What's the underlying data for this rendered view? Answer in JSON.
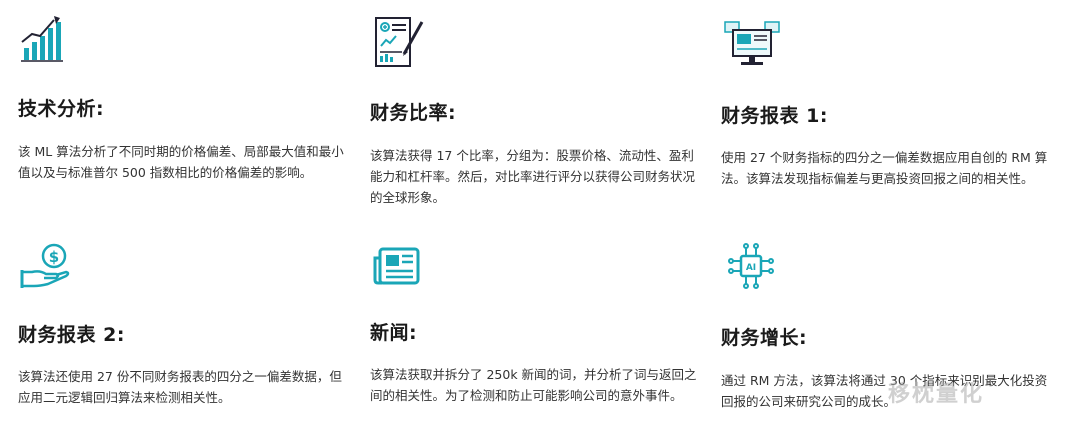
{
  "accent_color": "#1aa6b7",
  "cards": [
    {
      "icon": "growth-chart-icon",
      "title": "技术分析:",
      "desc": "该 ML 算法分析了不同时期的价格偏差、局部最大值和最小值以及与标准普尔 500 指数相比的价格偏差的影响。"
    },
    {
      "icon": "report-document-icon",
      "title": "财务比率:",
      "desc": "该算法获得 17 个比率，分组为：股票价格、流动性、盈利能力和杠杆率。然后，对比率进行评分以获得公司财务状况的全球形象。"
    },
    {
      "icon": "monitor-dashboard-icon",
      "title": "财务报表 1:",
      "desc": "使用 27 个财务指标的四分之一偏差数据应用自创的 RM 算法。该算法发现指标偏差与更高投资回报之间的相关性。"
    },
    {
      "icon": "money-hand-icon",
      "title": "财务报表 2:",
      "desc": "该算法还使用 27 份不同财务报表的四分之一偏差数据，但应用二元逻辑回归算法来检测相关性。"
    },
    {
      "icon": "newspaper-icon",
      "title": "新闻:",
      "desc": "该算法获取并拆分了 250k 新闻的词，并分析了词与返回之间的相关性。为了检测和防止可能影响公司的意外事件。"
    },
    {
      "icon": "ai-chip-icon",
      "title": "财务增长:",
      "desc": "通过 RM 方法，该算法将通过 30 个指标来识别最大化投资回报的公司来研究公司的成长。"
    }
  ],
  "watermark": "移枕量化"
}
